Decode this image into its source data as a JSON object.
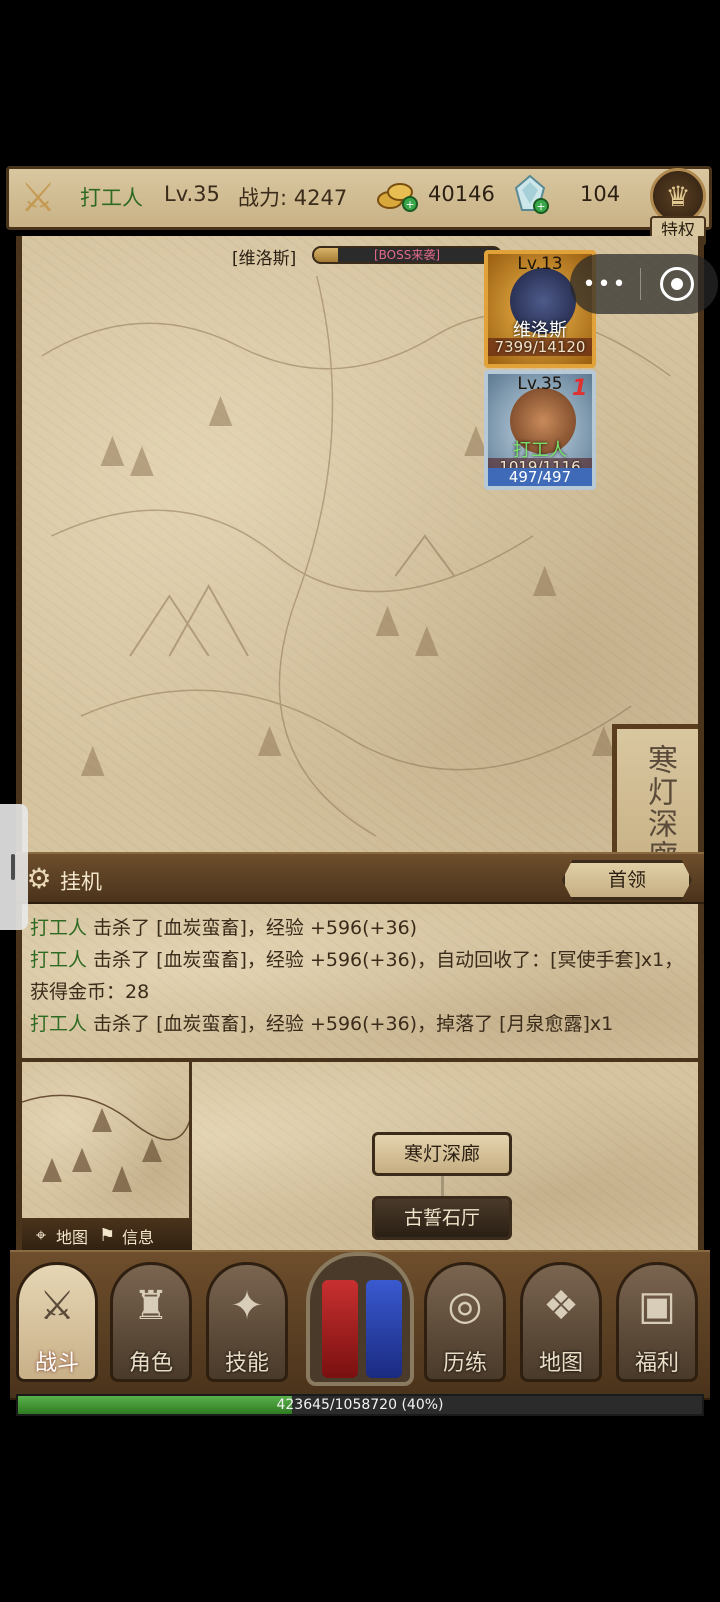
{
  "header": {
    "player_name": "打工人",
    "level": "Lv.35",
    "power": "战力: 4247",
    "gold": "40146",
    "gems": "104",
    "privilege_label": "特权"
  },
  "battle": {
    "boss_name": "[维洛斯]",
    "boss_banner": "[BOSS来袭]",
    "boss_bar_fraction": 0.13,
    "enemy": {
      "level": "Lv.13",
      "name": "维洛斯",
      "hp": "7399/14120"
    },
    "hero": {
      "level": "Lv.35",
      "name": "打工人",
      "hp": "1019/1116",
      "mp": "497/497",
      "damage_popup": "1"
    }
  },
  "capsule": {
    "more_label": "•••"
  },
  "zone_sign": "寒灯深廊",
  "idle_bar": {
    "label": "挂机",
    "leader_button": "首领"
  },
  "log": [
    {
      "who": "打工人",
      "text": " 击杀了 [血炭蛮畜]，经验 +596(+36)"
    },
    {
      "who": "打工人",
      "text": " 击杀了 [血炭蛮畜]，经验 +596(+36)，自动回收了：[冥使手套]x1，获得金币：28"
    },
    {
      "who": "打工人",
      "text": " 击杀了 [血炭蛮畜]，经验 +596(+36)，掉落了 [月泉愈露]x1"
    }
  ],
  "minimap": {
    "map_label": "地图",
    "info_label": "信息"
  },
  "route": {
    "current": "寒灯深廊",
    "next": "古誓石厅"
  },
  "nav": [
    {
      "label": "战斗",
      "icon": "crossed-swords-icon",
      "active": true
    },
    {
      "label": "角色",
      "icon": "helmet-icon"
    },
    {
      "label": "技能",
      "icon": "skill-claw-icon"
    },
    {
      "label": "历练",
      "icon": "vortex-icon"
    },
    {
      "label": "地图",
      "icon": "map-scroll-icon"
    },
    {
      "label": "福利",
      "icon": "treasure-chest-icon"
    }
  ],
  "exp": {
    "text": "423645/1058720 (40%)",
    "fraction": 0.4
  },
  "colors": {
    "accent_green": "#2f6a22",
    "wood": "#4a331b",
    "parchment": "#d6c4a0"
  }
}
